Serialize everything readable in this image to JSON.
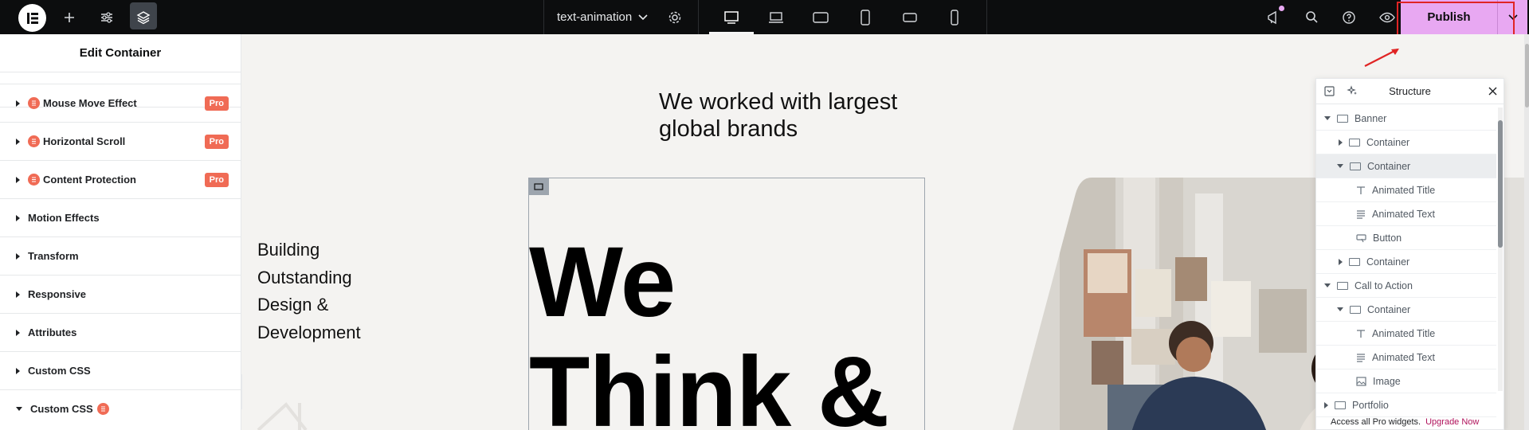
{
  "topbar": {
    "document_title": "text-animation",
    "publish_label": "Publish"
  },
  "left_panel": {
    "title": "Edit Container",
    "sections": [
      {
        "label": "Mouse Move Effect",
        "pro": true,
        "badge": "Pro"
      },
      {
        "label": "Horizontal Scroll",
        "pro": true,
        "badge": "Pro"
      },
      {
        "label": "Content Protection",
        "pro": true,
        "badge": "Pro"
      },
      {
        "label": "Motion Effects",
        "pro": false
      },
      {
        "label": "Transform",
        "pro": false
      },
      {
        "label": "Responsive",
        "pro": false
      },
      {
        "label": "Attributes",
        "pro": false
      },
      {
        "label": "Custom CSS",
        "pro": false
      },
      {
        "label": "Custom CSS",
        "pro": true,
        "expanded": true
      }
    ]
  },
  "canvas": {
    "heading_line1": "We worked with largest",
    "heading_line2": "global brands",
    "side_text": [
      "Building",
      "Outstanding",
      "Design &",
      "Development"
    ],
    "big_line1": "We",
    "big_line2": "Think &"
  },
  "structure": {
    "title": "Structure",
    "items": [
      {
        "label": "Banner",
        "icon": "container-icon",
        "toggle": "expanded"
      },
      {
        "label": "Container",
        "icon": "container-icon",
        "toggle": "collapsed"
      },
      {
        "label": "Container",
        "icon": "container-icon",
        "toggle": "expanded",
        "selected": true
      },
      {
        "label": "Animated Title",
        "icon": "title-icon"
      },
      {
        "label": "Animated Text",
        "icon": "text-icon"
      },
      {
        "label": "Button",
        "icon": "button-icon"
      },
      {
        "label": "Container",
        "icon": "container-icon",
        "toggle": "collapsed"
      },
      {
        "label": "Call to Action",
        "icon": "container-icon",
        "toggle": "expanded"
      },
      {
        "label": "Container",
        "icon": "container-icon",
        "toggle": "expanded"
      },
      {
        "label": "Animated Title",
        "icon": "title-icon"
      },
      {
        "label": "Animated Text",
        "icon": "text-icon"
      },
      {
        "label": "Image",
        "icon": "image-icon"
      },
      {
        "label": "Portfolio",
        "icon": "container-icon",
        "toggle": "collapsed"
      }
    ],
    "footer_text": "Access all Pro widgets.",
    "footer_link": "Upgrade Now"
  },
  "colors": {
    "accent_publish": "#e8a8f2",
    "pro_badge": "#f06b55",
    "annotation_red": "#e02424"
  }
}
